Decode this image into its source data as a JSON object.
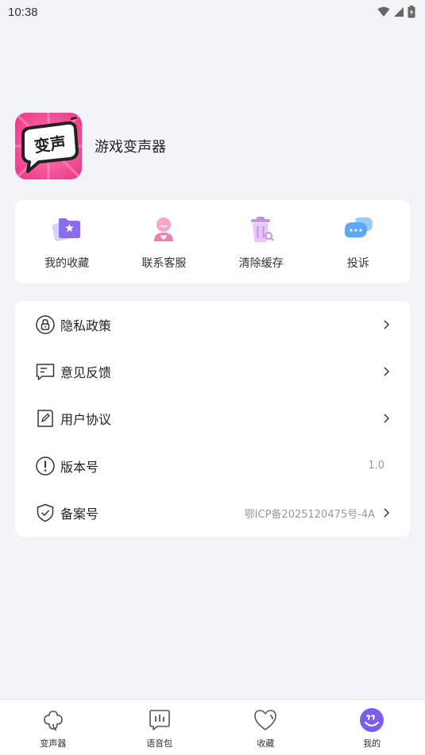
{
  "status_bar": {
    "time": "10:38"
  },
  "app": {
    "name": "游戏变声器",
    "logo_text": "变声"
  },
  "quick_actions": [
    {
      "label": "我的收藏",
      "icon": "favorites-folder-icon"
    },
    {
      "label": "联系客服",
      "icon": "customer-service-icon"
    },
    {
      "label": "清除缓存",
      "icon": "trash-icon"
    },
    {
      "label": "投诉",
      "icon": "chat-bubble-icon"
    }
  ],
  "menu": [
    {
      "label": "隐私政策",
      "icon": "lock-icon",
      "value": "",
      "has_arrow": true
    },
    {
      "label": "意见反馈",
      "icon": "feedback-icon",
      "value": "",
      "has_arrow": true
    },
    {
      "label": "用户协议",
      "icon": "document-edit-icon",
      "value": "",
      "has_arrow": true
    },
    {
      "label": "版本号",
      "icon": "info-exclamation-icon",
      "value": "1.0",
      "has_arrow": false
    },
    {
      "label": "备案号",
      "icon": "shield-check-icon",
      "value": "鄂ICP备2025120475号-4A",
      "has_arrow": true
    }
  ],
  "bottom_nav": [
    {
      "label": "变声器",
      "icon": "clover-icon",
      "active": false
    },
    {
      "label": "语音包",
      "icon": "voice-pack-icon",
      "active": false
    },
    {
      "label": "收藏",
      "icon": "heart-icon",
      "active": false
    },
    {
      "label": "我的",
      "icon": "profile-smile-icon",
      "active": true
    }
  ],
  "colors": {
    "background": "#f3f4f8",
    "logo_pink": "#f45aa0",
    "active_nav": "#7b5cf0",
    "favorites_purple": "#8a6cf0",
    "service_pink": "#f07cb0",
    "trash_purple": "#c78ef0",
    "chat_blue": "#5ca8f4"
  }
}
